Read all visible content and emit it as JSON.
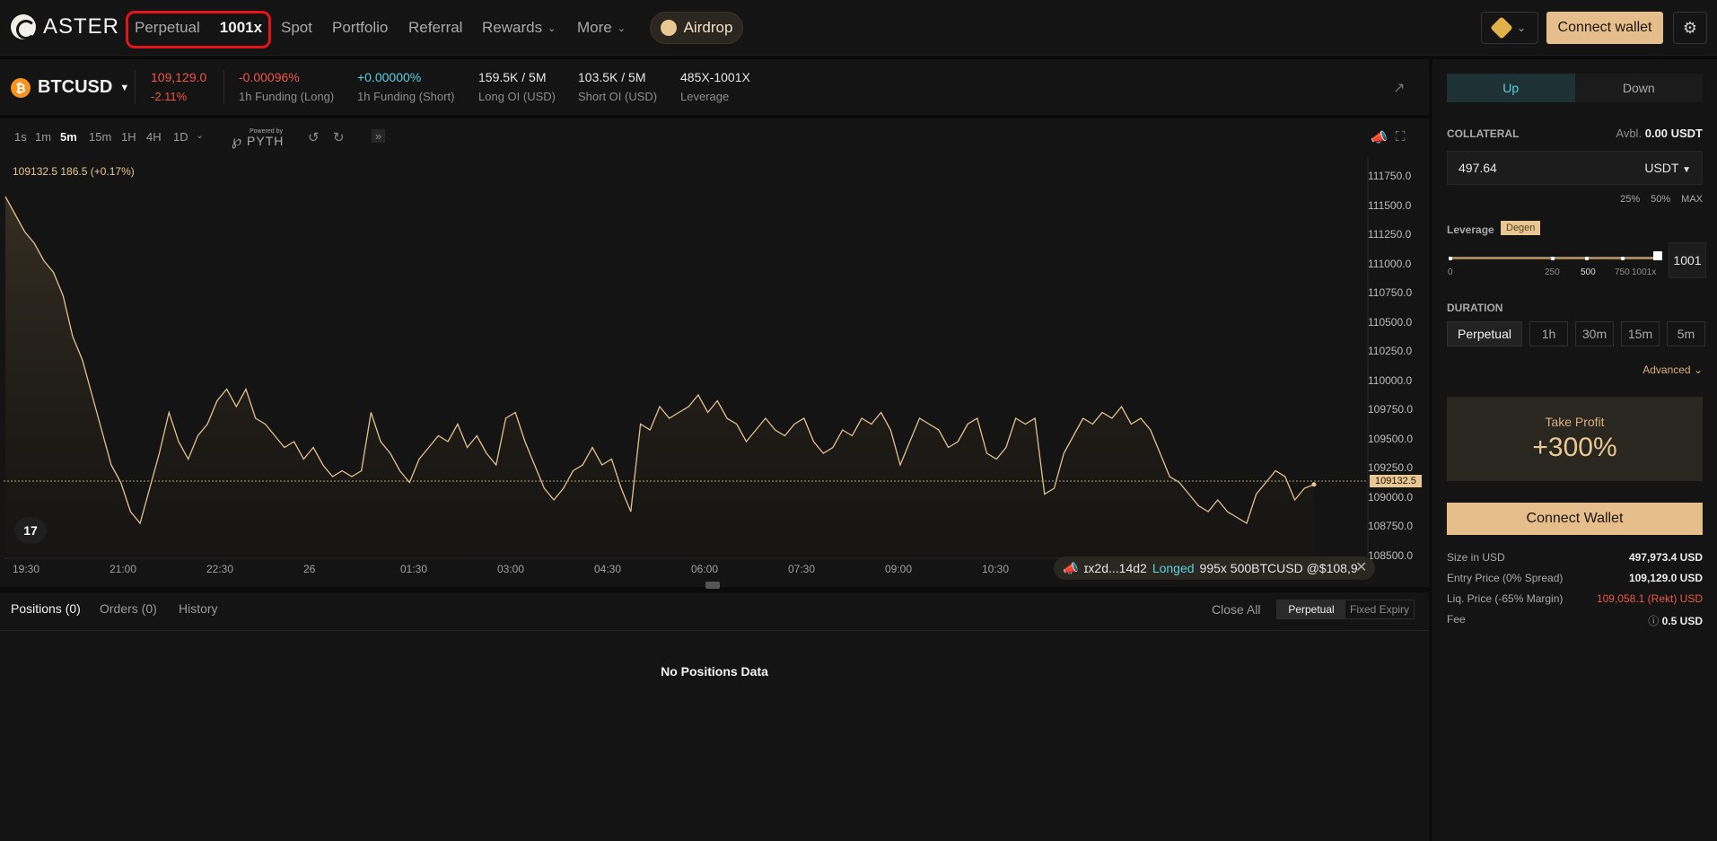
{
  "nav": {
    "logo_text": "ASTER",
    "perpetual": "Perpetual",
    "perpetual_badge": "1001x",
    "spot": "Spot",
    "portfolio": "Portfolio",
    "referral": "Referral",
    "rewards": "Rewards",
    "more": "More",
    "airdrop": "Airdrop",
    "connect_wallet": "Connect wallet"
  },
  "ticker": {
    "symbol": "BTCUSD",
    "price": "109,129.0",
    "change": "-2.11%",
    "funding_long_value": "-0.00096%",
    "funding_long_label": "1h Funding (Long)",
    "funding_short_value": "+0.00000%",
    "funding_short_label": "1h Funding (Short)",
    "long_oi_value": "159.5K / 5M",
    "long_oi_label": "Long OI (USD)",
    "short_oi_value": "103.5K / 5M",
    "short_oi_label": "Short OI (USD)",
    "leverage_value": "485X-1001X",
    "leverage_label": "Leverage"
  },
  "chart": {
    "timeframes": [
      "1s",
      "1m",
      "5m",
      "15m",
      "1H",
      "4H",
      "1D"
    ],
    "active_timeframe": "5m",
    "pyth_small": "Powered by",
    "pyth_big": "PYTH",
    "ohlc": "109132.5  186.5 (+0.17%)",
    "last_price": "109132.5",
    "price_ticks": [
      "111750.0",
      "111500.0",
      "111250.0",
      "111000.0",
      "110750.0",
      "110500.0",
      "110250.0",
      "110000.0",
      "109750.0",
      "109500.0",
      "109250.0",
      "109000.0",
      "108750.0",
      "108500.0"
    ],
    "time_ticks": [
      "19:30",
      "21:00",
      "22:30",
      "26",
      "01:30",
      "03:00",
      "04:30",
      "06:00",
      "07:30",
      "09:00",
      "10:30"
    ],
    "toast_addr": "ɪx2d...14d2",
    "toast_action": "Longed",
    "toast_detail": "995x 500BTCUSD @$108,9"
  },
  "chart_data": {
    "type": "area",
    "ylim": [
      108500,
      111900
    ],
    "values": [
      111600,
      111450,
      111300,
      111200,
      111050,
      110950,
      110750,
      110400,
      110200,
      109900,
      109600,
      109300,
      109150,
      108900,
      108800,
      109100,
      109400,
      109750,
      109500,
      109350,
      109550,
      109650,
      109850,
      109950,
      109800,
      109950,
      109700,
      109650,
      109550,
      109450,
      109500,
      109350,
      109450,
      109300,
      109200,
      109250,
      109200,
      109250,
      109750,
      109500,
      109400,
      109250,
      109150,
      109350,
      109450,
      109550,
      109500,
      109650,
      109450,
      109550,
      109400,
      109300,
      109700,
      109750,
      109500,
      109300,
      109100,
      109000,
      109100,
      109250,
      109300,
      109450,
      109300,
      109350,
      109100,
      108900,
      109650,
      109600,
      109800,
      109700,
      109750,
      109800,
      109900,
      109750,
      109850,
      109700,
      109650,
      109500,
      109600,
      109700,
      109600,
      109550,
      109650,
      109700,
      109500,
      109400,
      109450,
      109600,
      109550,
      109700,
      109650,
      109750,
      109600,
      109300,
      109500,
      109700,
      109650,
      109600,
      109450,
      109500,
      109650,
      109700,
      109400,
      109350,
      109450,
      109700,
      109650,
      109700,
      109050,
      109100,
      109400,
      109550,
      109700,
      109650,
      109750,
      109700,
      109800,
      109650,
      109700,
      109600,
      109400,
      109200,
      109150,
      109050,
      108950,
      108900,
      109000,
      108900,
      108850,
      108800,
      109050,
      109150,
      109250,
      109200,
      109000,
      109100,
      109132.5
    ]
  },
  "positions": {
    "tab_positions": "Positions (0)",
    "tab_orders": "Orders (0)",
    "tab_history": "History",
    "close_all": "Close All",
    "seg_perpetual": "Perpetual",
    "seg_fixed": "Fixed Expiry",
    "empty": "No Positions Data"
  },
  "order": {
    "up": "Up",
    "down": "Down",
    "collateral_label": "COLLATERAL",
    "avbl_label": "Avbl.",
    "avbl_value": "0.00 USDT",
    "collateral_value": "497.64",
    "collateral_unit": "USDT",
    "pct25": "25%",
    "pct50": "50%",
    "pct_max": "MAX",
    "leverage_label": "Leverage",
    "degen": "Degen",
    "leverage_value": "1001",
    "slider_fill_fraction": 1.0,
    "ticks": [
      "0",
      "250",
      "500",
      "750",
      "1001x"
    ],
    "duration_label": "DURATION",
    "durations": [
      "Perpetual",
      "1h",
      "30m",
      "15m",
      "5m"
    ],
    "advanced": "Advanced",
    "take_profit_label": "Take Profit",
    "take_profit_value": "+300%",
    "connect_wallet": "Connect Wallet",
    "size_label": "Size in USD",
    "size_value": "497,973.4 USD",
    "entry_label": "Entry Price (0% Spread)",
    "entry_value": "109,129.0 USD",
    "liq_label": "Liq. Price (-65% Margin)",
    "liq_value": "109,058.1 (Rekt) USD",
    "fee_label": "Fee",
    "fee_value": "0.5 USD"
  }
}
